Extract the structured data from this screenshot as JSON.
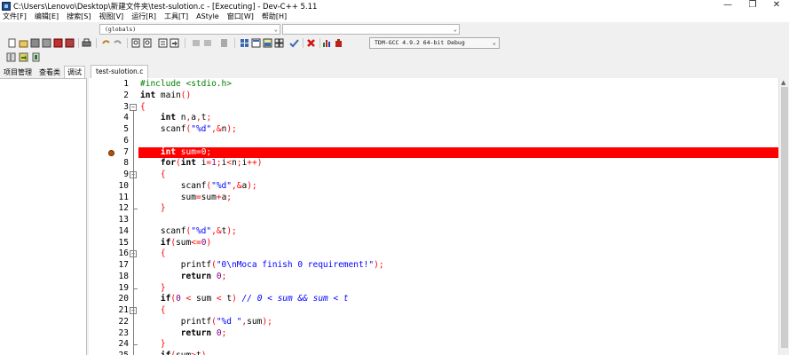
{
  "window": {
    "title": "C:\\Users\\Lenovo\\Desktop\\新建文件夹\\test-sulotion.c - [Executing] - Dev-C++ 5.11",
    "minimize": "—",
    "maximize": "❐",
    "close": "✕"
  },
  "menu": [
    "文件[F]",
    "编辑[E]",
    "搜索[S]",
    "视图[V]",
    "运行[R]",
    "工具[T]",
    "AStyle",
    "窗口[W]",
    "帮助[H]"
  ],
  "toolbar": {
    "scope_combo": "(globals)",
    "symbol_combo": "",
    "compiler_combo": "TDM-GCC 4.9.2 64-bit Debug"
  },
  "left_panel": {
    "tabs": [
      "项目管理",
      "查看类",
      "调试"
    ],
    "active_tab": 2
  },
  "editor": {
    "tab_label": "test-sulotion.c",
    "highlight_color": "#ff0000",
    "breakpoint_line": 7,
    "lines": [
      {
        "n": "1",
        "fold": "",
        "text": "#include <stdio.h>"
      },
      {
        "n": "2",
        "fold": "",
        "text": "int main()"
      },
      {
        "n": "3",
        "fold": "⊟",
        "text": "{"
      },
      {
        "n": "4",
        "fold": "",
        "text": "    int n,a,t;"
      },
      {
        "n": "5",
        "fold": "",
        "text": "    scanf(\"%d\",&n);"
      },
      {
        "n": "6",
        "fold": "",
        "text": ""
      },
      {
        "n": "7",
        "fold": "",
        "text": "    int sum=0;"
      },
      {
        "n": "8",
        "fold": "",
        "text": "    for(int i=1;i<n;i++)"
      },
      {
        "n": "9",
        "fold": "⊟",
        "text": "    {"
      },
      {
        "n": "10",
        "fold": "",
        "text": "        scanf(\"%d\",&a);"
      },
      {
        "n": "11",
        "fold": "",
        "text": "        sum=sum+a;"
      },
      {
        "n": "12",
        "fold": "",
        "text": "    }"
      },
      {
        "n": "13",
        "fold": "",
        "text": ""
      },
      {
        "n": "14",
        "fold": "",
        "text": "    scanf(\"%d\",&t);"
      },
      {
        "n": "15",
        "fold": "",
        "text": "    if(sum<=0)"
      },
      {
        "n": "16",
        "fold": "⊟",
        "text": "    {"
      },
      {
        "n": "17",
        "fold": "",
        "text": "        printf(\"0\\nMoca finish 0 requirement!\");"
      },
      {
        "n": "18",
        "fold": "",
        "text": "        return 0;"
      },
      {
        "n": "19",
        "fold": "",
        "text": "    }"
      },
      {
        "n": "20",
        "fold": "",
        "text": "    if(0 < sum < t) // 0 < sum && sum < t"
      },
      {
        "n": "21",
        "fold": "⊟",
        "text": "    {"
      },
      {
        "n": "22",
        "fold": "",
        "text": "        printf(\"%d \",sum);"
      },
      {
        "n": "23",
        "fold": "",
        "text": "        return 0;"
      },
      {
        "n": "24",
        "fold": "",
        "text": "    }"
      },
      {
        "n": "25",
        "fold": "",
        "text": "    if(sum>t)"
      }
    ]
  }
}
